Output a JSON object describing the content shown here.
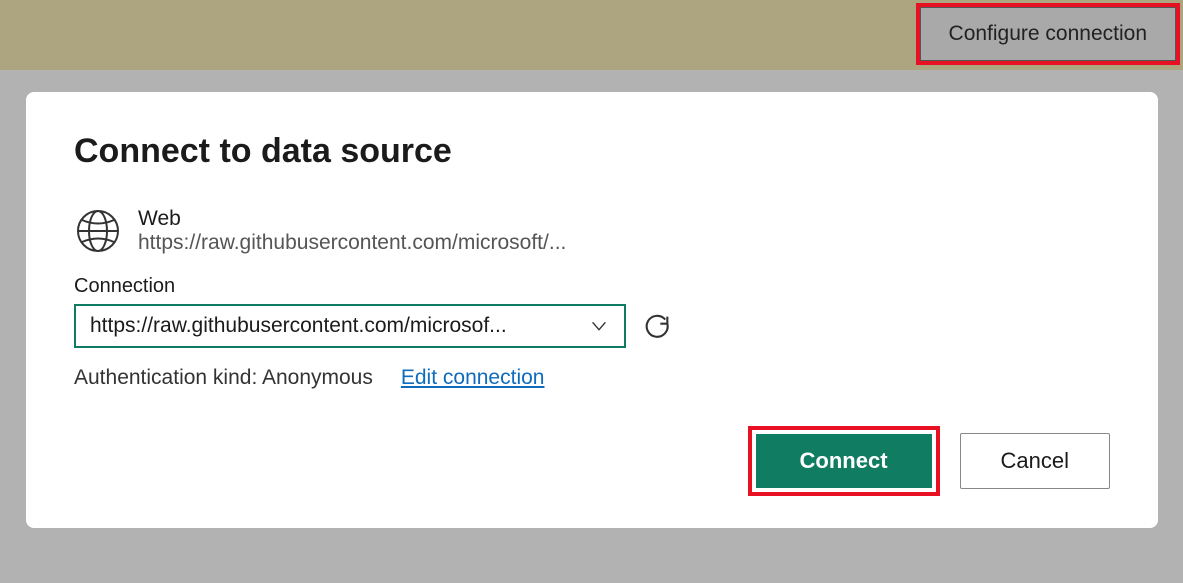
{
  "top": {
    "configure_label": "Configure connection"
  },
  "dialog": {
    "title": "Connect to data source",
    "source": {
      "name": "Web",
      "url": "https://raw.githubusercontent.com/microsoft/..."
    },
    "connection": {
      "label": "Connection",
      "selected": "https://raw.githubusercontent.com/microsof..."
    },
    "auth": {
      "text": "Authentication kind: Anonymous",
      "edit_label": "Edit connection"
    },
    "buttons": {
      "connect": "Connect",
      "cancel": "Cancel"
    }
  }
}
